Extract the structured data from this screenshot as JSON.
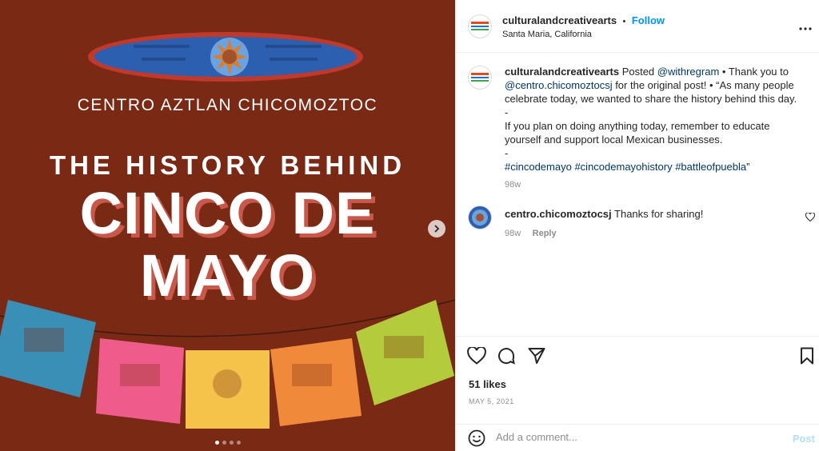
{
  "media": {
    "org_name": "CENTRO AZTLAN CHICOMOZTOC",
    "headline_line1": "THE HISTORY BEHIND",
    "headline_line2": "CINCO DE",
    "headline_line3": "MAYO",
    "carousel_count": 4,
    "carousel_active": 1,
    "colors": {
      "background": "#7a2a14",
      "headline_shadow": "#c9584a"
    }
  },
  "header": {
    "username": "culturalandcreativearts",
    "separator": "•",
    "follow_label": "Follow",
    "location": "Santa Maria, California",
    "more_icon": "more-horizontal-icon"
  },
  "caption": {
    "username": "culturalandcreativearts",
    "text_posted": " Posted ",
    "mention1": "@withregram",
    "text_thanks": " • Thank you to ",
    "mention2": "@centro.chicomoztocsj",
    "text_original": " for the original post! • “As many people celebrate today, we wanted to share the history behind this day.",
    "dash1": "-",
    "paragraph2": "If you plan on doing anything today, remember to educate yourself and support local Mexican businesses.",
    "dash2": "-",
    "hashtag1": "#cincodemayo",
    "hashtag2": "#cincodemayohistory",
    "hashtag3": "#battleofpuebla",
    "closing_quote": "”",
    "time": "98w"
  },
  "comment": {
    "username": "centro.chicomoztocsj",
    "text": "Thanks for sharing!",
    "time": "98w",
    "reply_label": "Reply"
  },
  "actions": {
    "likes": "51 likes",
    "date": "MAY 5, 2021"
  },
  "add_comment": {
    "placeholder": "Add a comment...",
    "post_label": "Post"
  }
}
